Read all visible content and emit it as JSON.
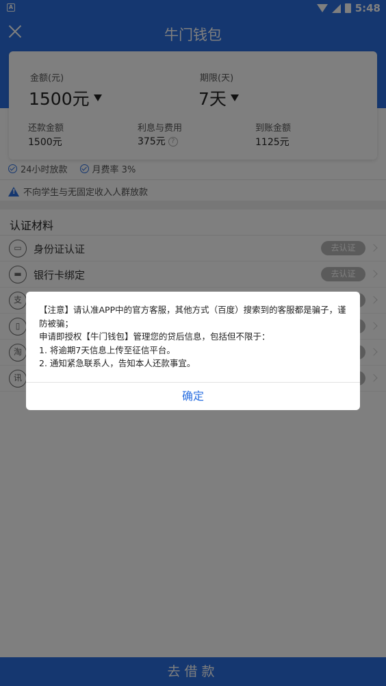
{
  "status_bar": {
    "time": "5:48",
    "left_badge": "A"
  },
  "header": {
    "title": "牛门钱包"
  },
  "loan": {
    "amount_label": "金额(元)",
    "amount_value": "1500元",
    "term_label": "期限(天)",
    "term_value": "7天",
    "repay_label": "还款金额",
    "repay_value": "1500元",
    "fee_label": "利息与费用",
    "fee_value": "375元",
    "fee_help": "?",
    "received_label": "到账金额",
    "received_value": "1125元"
  },
  "tags": [
    {
      "label": "24小时放款"
    },
    {
      "label": "月费率 3%"
    }
  ],
  "notice": "不向学生与无固定收入人群放款",
  "materials": {
    "title": "认证材料",
    "items": [
      {
        "label": "身份证认证",
        "icon": "id",
        "action": "去认证"
      },
      {
        "label": "银行卡绑定",
        "icon": "card",
        "action": "去认证"
      },
      {
        "label": "",
        "icon": "支",
        "action": ""
      },
      {
        "label": "",
        "icon": "phone",
        "action": ""
      },
      {
        "label": "",
        "icon": "淘",
        "action": ""
      },
      {
        "label": "",
        "icon": "讯",
        "action": ""
      }
    ]
  },
  "bottom_button": "去借款",
  "dialog": {
    "lines": [
      "【注意】请认准APP中的官方客服，其他方式（百度）搜索到的客服都是骗子，谨防被骗；",
      "申请即授权【牛门钱包】管理您的贷后信息，包括但不限于：",
      "1. 将逾期7天信息上传至征信平台。",
      "2. 通知紧急联系人，告知本人还款事宜。"
    ],
    "confirm": "确定"
  },
  "colors": {
    "primary": "#2b6fe0"
  }
}
